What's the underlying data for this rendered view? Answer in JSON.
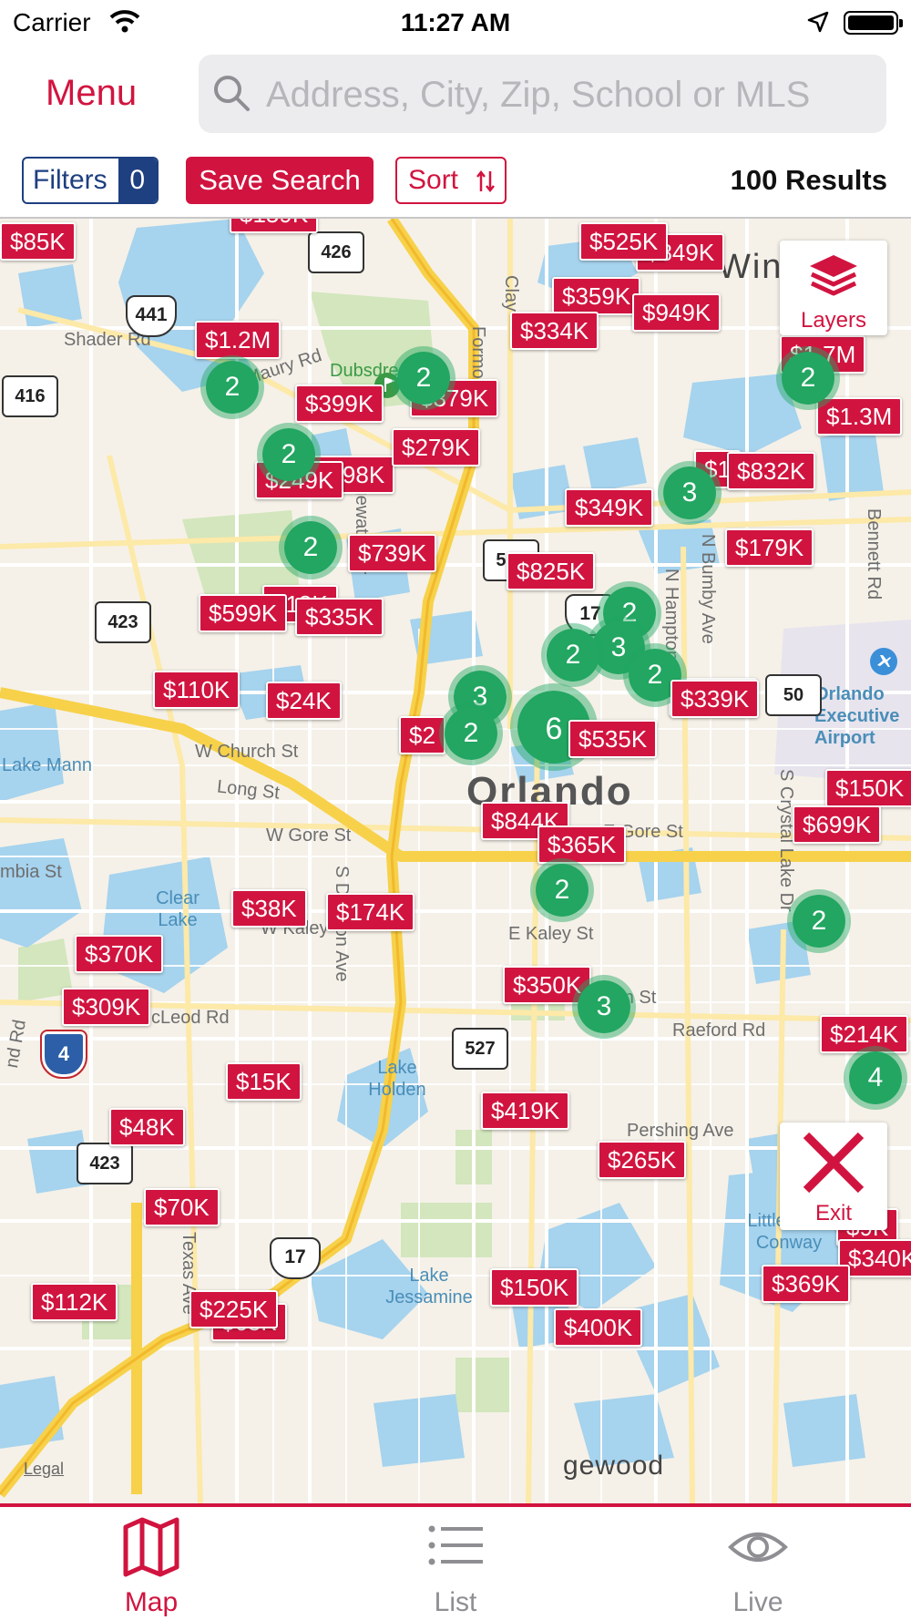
{
  "status_bar": {
    "carrier": "Carrier",
    "time": "11:27 AM"
  },
  "header": {
    "menu_label": "Menu",
    "search_placeholder": "Address, City, Zip, School or MLS"
  },
  "toolbar": {
    "filters_label": "Filters",
    "filters_count": "0",
    "save_search_label": "Save Search",
    "sort_label": "Sort",
    "results_text": "100 Results"
  },
  "map": {
    "layers_label": "Layers",
    "exit_label": "Exit",
    "legal_label": "Legal",
    "city_label": "Orlando",
    "street_labels": [
      "Shader Rd",
      "Maury Rd",
      "W Church St",
      "Long St",
      "W Gore St",
      "mbia St",
      "W Kaley",
      "cLeod Rd",
      "E Gore St",
      "E Kaley St",
      "igan St",
      "Raeford Rd",
      "Pershing Ave",
      "S Division Ave",
      "Edgewater Dr",
      "Formosa",
      "Clay",
      "N Hampton",
      "N Bumby Ave",
      "Bennett Rd",
      "S Crystal Lake Dr",
      "Texas Ave",
      "nd Rd",
      "gewood",
      "Win"
    ],
    "water_labels": [
      "Lake Mann",
      "Clear Lake",
      "Lake Holden",
      "Lake Jessamine",
      "Little Lake Conway"
    ],
    "park_labels": [
      "Dubsdread"
    ],
    "airport_label": "Orlando Executive Airport",
    "highway_shields": [
      "426",
      "441",
      "416",
      "423",
      "527",
      "17",
      "50",
      "527",
      "4",
      "423",
      "17"
    ],
    "price_pins": [
      "$85K",
      "$159K",
      "$849K",
      "$525K",
      "$359K",
      "$949K",
      "$334K",
      "$1.2M",
      "$1.7M",
      "$1.3M",
      "$399K",
      "$379K",
      "$279K",
      "$298K",
      "$249K",
      "$1",
      "$832K",
      "$349K",
      "$739K",
      "$179K",
      "$825K",
      "$18K",
      "$599K",
      "$335K",
      "$110K",
      "$24K",
      "$339K",
      "$2",
      "$535K",
      "$150K",
      "$844K",
      "$699K",
      "$365K",
      "$38K",
      "$174K",
      "$370K",
      "$350K",
      "$309K",
      "$214K",
      "$15K",
      "$419K",
      "$48K",
      "$265K",
      "$9K",
      "$70K",
      "$340K",
      "$150K",
      "$369K",
      "$112K",
      "$225K",
      "$400K",
      "$63K"
    ],
    "clusters": [
      "2",
      "2",
      "2",
      "2",
      "2",
      "3",
      "2",
      "3",
      "2",
      "3",
      "2",
      "6",
      "2",
      "2",
      "3",
      "4"
    ]
  },
  "tabs": [
    {
      "label": "Map",
      "icon": "map-icon",
      "active": true
    },
    {
      "label": "List",
      "icon": "list-icon",
      "active": false
    },
    {
      "label": "Live",
      "icon": "eye-icon",
      "active": false
    }
  ],
  "colors": {
    "accent": "#d1143f",
    "navy": "#1e3f80",
    "cluster": "#22a661",
    "highway": "#f7d14a",
    "water": "#a6d3ee"
  }
}
